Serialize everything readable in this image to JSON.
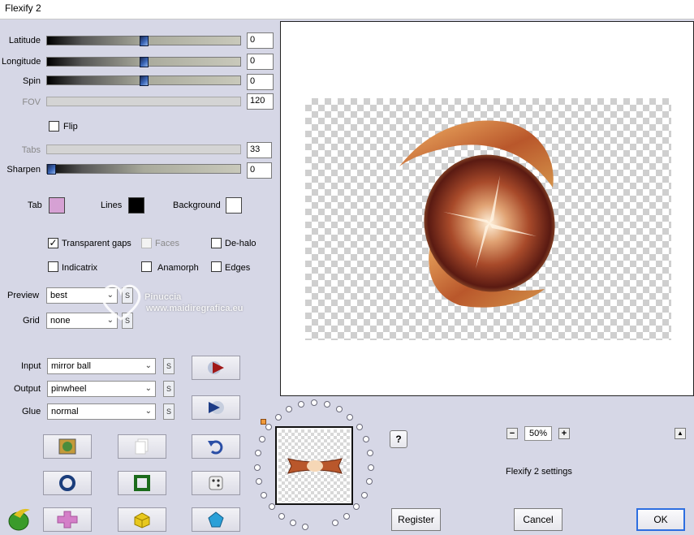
{
  "window": {
    "title": "Flexify 2"
  },
  "sliders": [
    {
      "label": "Latitude",
      "value": "0",
      "level": 0.5,
      "enabled": true
    },
    {
      "label": "Longitude",
      "value": "0",
      "level": 0.5,
      "enabled": true
    },
    {
      "label": "Spin",
      "value": "0",
      "level": 0.5,
      "enabled": true
    },
    {
      "label": "FOV",
      "value": "120",
      "level": null,
      "enabled": false
    },
    {
      "label": "Tabs",
      "value": "33",
      "level": null,
      "enabled": false
    },
    {
      "label": "Sharpen",
      "value": "0",
      "level": 0.0,
      "enabled": true
    }
  ],
  "flip": {
    "label": "Flip",
    "checked": false
  },
  "colors": {
    "tab_label": "Tab",
    "tab_color": "#d6a1d4",
    "lines_label": "Lines",
    "lines_color": "#000000",
    "background_label": "Background",
    "background_color": "#ffffff"
  },
  "options": {
    "transparent_gaps": {
      "label": "Transparent gaps",
      "checked": true
    },
    "faces": {
      "label": "Faces",
      "checked": false
    },
    "de_halo": {
      "label": "De-halo",
      "checked": false
    },
    "indicatrix": {
      "label": "Indicatrix",
      "checked": false
    },
    "anamorph": {
      "label": "Anamorph",
      "checked": false
    },
    "edges": {
      "label": "Edges",
      "checked": false
    }
  },
  "preview_select": {
    "label": "Preview",
    "value": "best"
  },
  "grid_select": {
    "label": "Grid",
    "value": "none"
  },
  "input_select": {
    "label": "Input",
    "value": "mirror ball"
  },
  "output_select": {
    "label": "Output",
    "value": "pinwheel"
  },
  "glue_select": {
    "label": "Glue",
    "value": "normal"
  },
  "swap_label": "S",
  "lock_label": "S",
  "watermark": {
    "line1": "Pinuccia",
    "line2": "www.maidiregrafica.eu"
  },
  "zoom": {
    "minus": "−",
    "value": "50%",
    "plus": "+"
  },
  "help": {
    "label": "?"
  },
  "scroll_up": {
    "label": "▲"
  },
  "settings_label": "Flexify 2 settings",
  "buttons": {
    "register": "Register",
    "cancel": "Cancel",
    "ok": "OK"
  },
  "accent": "#2d6ee0"
}
